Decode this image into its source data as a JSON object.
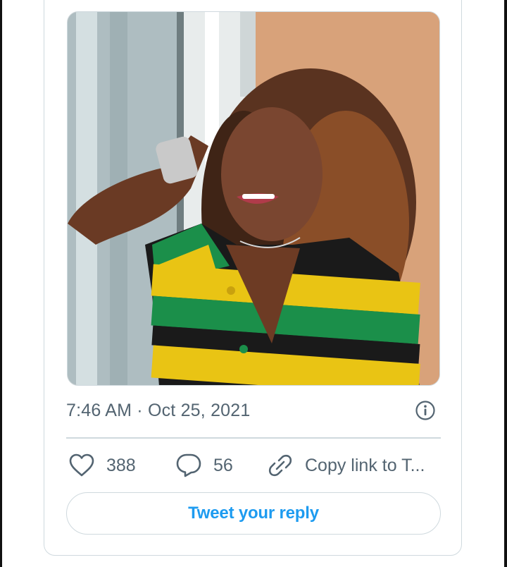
{
  "tweet": {
    "timestamp": "7:46 AM · Oct 25, 2021",
    "photo": {
      "description_icon": "photo"
    },
    "actions": {
      "like": {
        "icon": "heart-icon",
        "count": "388"
      },
      "reply": {
        "icon": "speech-bubble-icon",
        "count": "56"
      },
      "copy_link": {
        "icon": "link-icon",
        "label": "Copy link to T..."
      }
    },
    "reply_button_label": "Tweet your reply",
    "info_icon": "info-icon"
  },
  "colors": {
    "accent": "#1d9bf0",
    "secondary_text": "#536471",
    "border": "#cfd9de"
  }
}
